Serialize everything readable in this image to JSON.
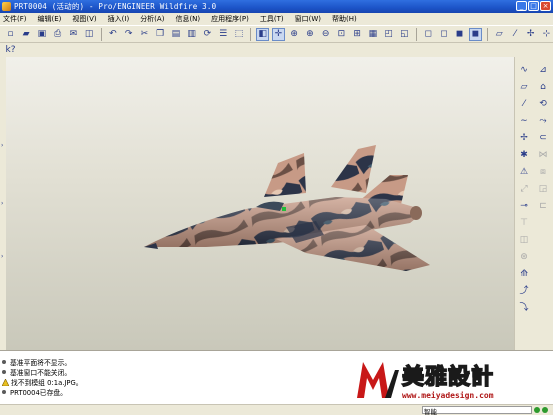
{
  "window": {
    "title": "PRT0004 (活动的) - Pro/ENGINEER Wildfire 3.0",
    "buttons": {
      "minimize": "_",
      "maximize": "□",
      "close": "×"
    }
  },
  "menu": [
    "文件(F)",
    "编辑(E)",
    "视图(V)",
    "插入(I)",
    "分析(A)",
    "信息(N)",
    "应用程序(P)",
    "工具(T)",
    "窗口(W)",
    "帮助(H)"
  ],
  "toolbar": {
    "row1_icons": [
      "new-icon",
      "open-icon",
      "save-icon",
      "print-icon",
      "email-icon",
      "save-copy-icon",
      "undo-icon",
      "redo-icon",
      "cut-icon",
      "copy-icon",
      "paste-icon",
      "paste-special-icon",
      "regenerate-icon",
      "model-tree-icon",
      "select-icon",
      "repaint-icon",
      "spin-center-icon",
      "orient-icon",
      "zoom-in-icon",
      "zoom-out-icon",
      "refit-icon",
      "reorient-icon",
      "saved-views-icon",
      "layers-icon",
      "view-manager-icon",
      "wireframe-icon",
      "hidden-line-icon",
      "no-hidden-icon",
      "shaded-icon",
      "datum-planes-icon",
      "datum-axes-icon",
      "datum-points-icon",
      "coord-sys-icon"
    ],
    "row2_icons": [
      "context-help-icon"
    ]
  },
  "right_toolbar_icons": [
    "plane-icon",
    "sketch-icon",
    "datum-plane-icon",
    "datum-axis-icon",
    "datum-curve-icon",
    "datum-point-icon",
    "coord-icon",
    "analysis-icon",
    "extrude-icon",
    "revolve-icon",
    "variable-sweep-icon",
    "blend-icon",
    "boundary-blend-icon",
    "style-icon",
    "hole-icon",
    "shell-icon",
    "rib-icon",
    "draft-icon",
    "round-icon",
    "chamfer-icon",
    "pattern-icon",
    "mirror-icon",
    "merge-icon",
    "trim-icon",
    "offset-icon",
    "thicken-icon",
    "solidify-icon"
  ],
  "messages": [
    "基准平面将不显示。",
    "基准窗口不能关闭。",
    "找不到模组 0:1a.JPG。",
    "PRT0004已存盘。"
  ],
  "watermark": {
    "brand": "美雅設計",
    "url": "www.meiyadesign.com"
  },
  "status": {
    "filter": "智能"
  }
}
